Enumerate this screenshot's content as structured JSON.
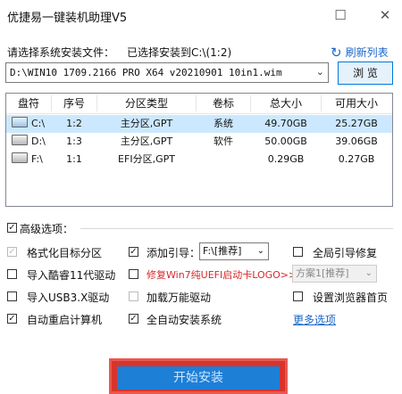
{
  "window": {
    "title": "优捷易一键装机助理V5",
    "minimize_glyph": "☐",
    "close_glyph": "✕"
  },
  "toolbar": {
    "prompt": "请选择系统安装文件：",
    "status": "已选择安装到C:\\(1:2)",
    "refresh_label": "刷新列表",
    "refresh_icon": "refresh-icon",
    "image_path": "D:\\WIN10 1709.2166 PRO X64 v20210901 10in1.wim",
    "browse_label": "浏 览"
  },
  "partitions": {
    "columns": [
      "盘符",
      "序号",
      "分区类型",
      "卷标",
      "总大小",
      "可用大小"
    ],
    "rows": [
      {
        "drive": "C:\\",
        "index": "1:2",
        "type": "主分区,GPT",
        "label": "系统",
        "total": "49.70GB",
        "free": "25.27GB",
        "selected": true,
        "icon": "windows-drive-icon"
      },
      {
        "drive": "D:\\",
        "index": "1:3",
        "type": "主分区,GPT",
        "label": "软件",
        "total": "50.00GB",
        "free": "39.06GB",
        "selected": false,
        "icon": "drive-icon"
      },
      {
        "drive": "F:\\",
        "index": "1:1",
        "type": "EFI分区,GPT",
        "label": "",
        "total": "0.29GB",
        "free": "0.27GB",
        "selected": false,
        "icon": "drive-icon"
      }
    ]
  },
  "advanced": {
    "label": "高级选项：",
    "checked": true,
    "options": {
      "format_target": {
        "label": "格式化目标分区",
        "checked": true,
        "disabled": true
      },
      "add_boot": {
        "label": "添加引导：",
        "checked": true,
        "value": "F:\\[推荐]"
      },
      "global_boot_fix": {
        "label": "全局引导修复",
        "checked": false
      },
      "import_11th": {
        "label": "导入酷睿11代驱动",
        "checked": false
      },
      "fix_win7": {
        "label": "修复Win7纯UEFI启动卡LOGO>>",
        "checked": false,
        "value": "方案1[推荐]"
      },
      "import_usb3": {
        "label": "导入USB3.X驱动",
        "checked": false
      },
      "load_universal": {
        "label": "加载万能驱动",
        "checked": false,
        "disabled": true
      },
      "set_homepage": {
        "label": "设置浏览器首页",
        "checked": false
      },
      "auto_restart": {
        "label": "自动重启计算机",
        "checked": true
      },
      "auto_install": {
        "label": "全自动安装系统",
        "checked": true
      },
      "more_link": "更多选项"
    }
  },
  "start_button": {
    "label": "开始安装"
  },
  "colors": {
    "accent": "#1a66c8",
    "danger": "#d4292b",
    "selected_row": "#cce8ff",
    "start_outer": "#d9342b",
    "start_inner": "#1d7fd6"
  }
}
